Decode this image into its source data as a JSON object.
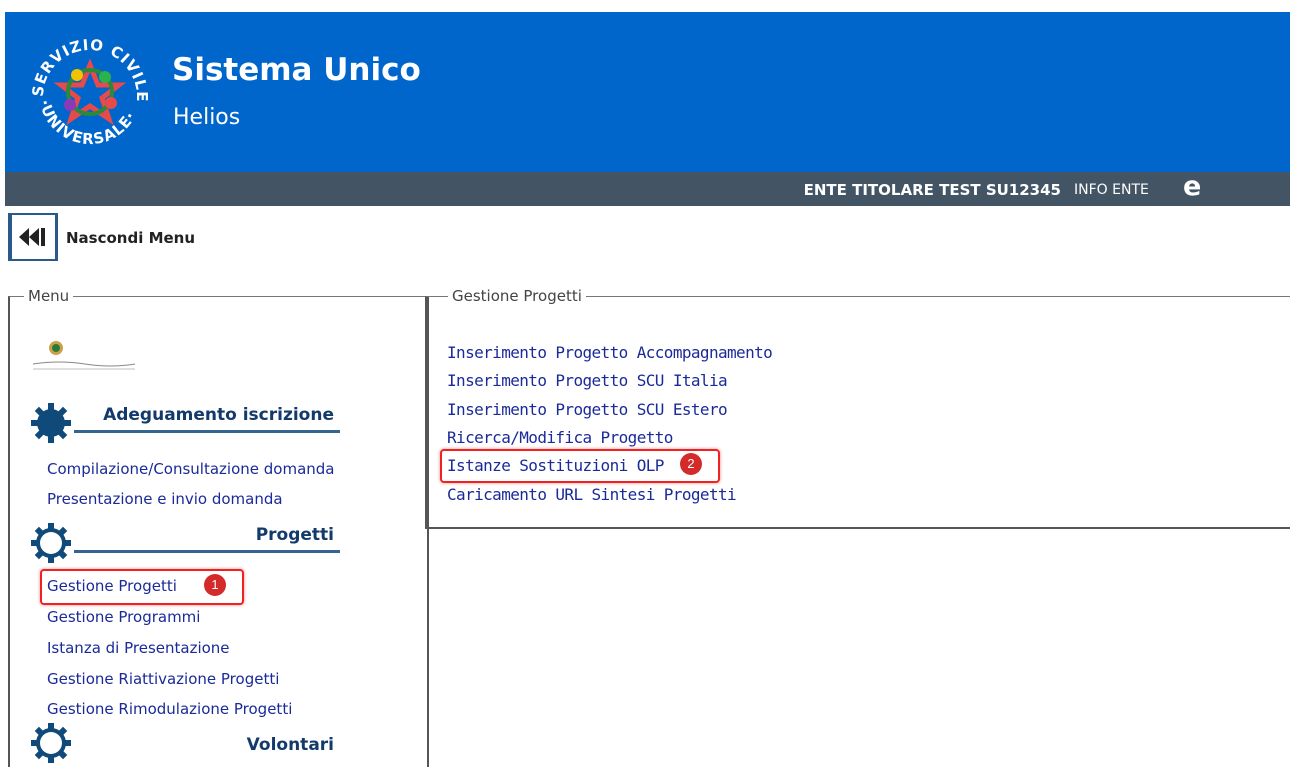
{
  "header": {
    "title": "Sistema Unico",
    "subtitle": "Helios",
    "logo_text": "SERVIZIO CIVILE UNIVERSALE",
    "brand_color": "#0066cc"
  },
  "userbar": {
    "ente": "ENTE TITOLARE TEST  SU12345",
    "info": "INFO ENTE",
    "ie_icon": "e"
  },
  "toolbar": {
    "collapse_label": "Nascondi Menu"
  },
  "menu": {
    "legend": "Menu",
    "sections": [
      {
        "title": "Adeguamento iscrizione",
        "items": [
          "Compilazione/Consultazione domanda",
          "Presentazione e invio domanda"
        ]
      },
      {
        "title": "Progetti",
        "items": [
          "Gestione Progetti",
          "Gestione Programmi",
          "Istanza di Presentazione",
          "Gestione Riattivazione Progetti",
          "Gestione Rimodulazione Progetti"
        ]
      },
      {
        "title": "Volontari",
        "items": []
      }
    ]
  },
  "gestione": {
    "legend": "Gestione Progetti",
    "links": [
      "Inserimento Progetto Accompagnamento",
      "Inserimento Progetto SCU Italia",
      "Inserimento Progetto SCU Estero",
      "Ricerca/Modifica Progetto",
      "Istanze Sostituzioni OLP",
      "Caricamento URL Sintesi Progetti"
    ]
  },
  "annotations": {
    "step1": "1",
    "step2": "2",
    "highlight_color": "#e22222"
  }
}
